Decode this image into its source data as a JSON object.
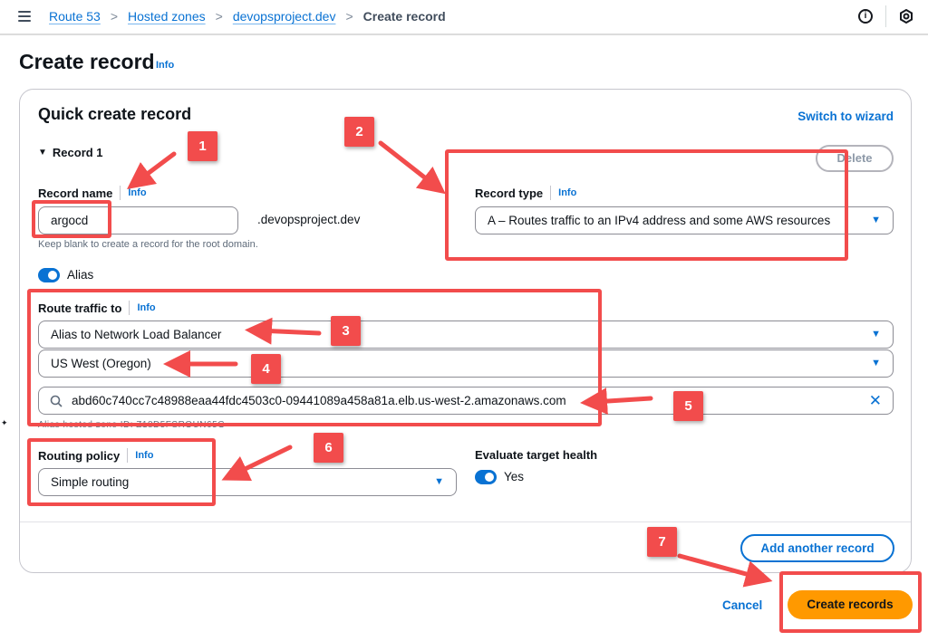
{
  "breadcrumb": {
    "items": [
      "Route 53",
      "Hosted zones",
      "devopsproject.dev"
    ],
    "current": "Create record",
    "separator": ">"
  },
  "header_icons": {
    "menu": "hamburger-menu-icon",
    "info": "info-circle-icon",
    "info_glyph": "i",
    "settings": "hexagon-settings-icon"
  },
  "page": {
    "title": "Create record",
    "info": "Info"
  },
  "card": {
    "title": "Quick create record",
    "switch_link": "Switch to wizard",
    "record_section": "Record 1",
    "delete_button": "Delete",
    "record_name": {
      "label": "Record name",
      "info": "Info",
      "value": "argocd",
      "suffix": ".devopsproject.dev",
      "hint": "Keep blank to create a record for the root domain."
    },
    "record_type": {
      "label": "Record type",
      "info": "Info",
      "value": "A – Routes traffic to an IPv4 address and some AWS resources"
    },
    "alias": {
      "label": "Alias",
      "enabled": true
    },
    "route_traffic": {
      "label": "Route traffic to",
      "info": "Info",
      "endpoint_type": "Alias to Network Load Balancer",
      "region": "US West (Oregon)",
      "load_balancer": "abd60c740cc7c48988eaa44fdc4503c0-09441089a458a81a.elb.us-west-2.amazonaws.com",
      "hosted_zone_hint": "Alias hosted zone ID: Z18D5FSROUN65G"
    },
    "routing_policy": {
      "label": "Routing policy",
      "info": "Info",
      "value": "Simple routing"
    },
    "evaluate_health": {
      "label": "Evaluate target health",
      "value_label": "Yes",
      "enabled": true
    },
    "add_button": "Add another record"
  },
  "footer": {
    "cancel": "Cancel",
    "create": "Create records"
  },
  "annotations": [
    "1",
    "2",
    "3",
    "4",
    "5",
    "6",
    "7"
  ],
  "colors": {
    "link": "#0972d3",
    "primary_button": "#ff9900",
    "annotation": "#f24c4c"
  }
}
